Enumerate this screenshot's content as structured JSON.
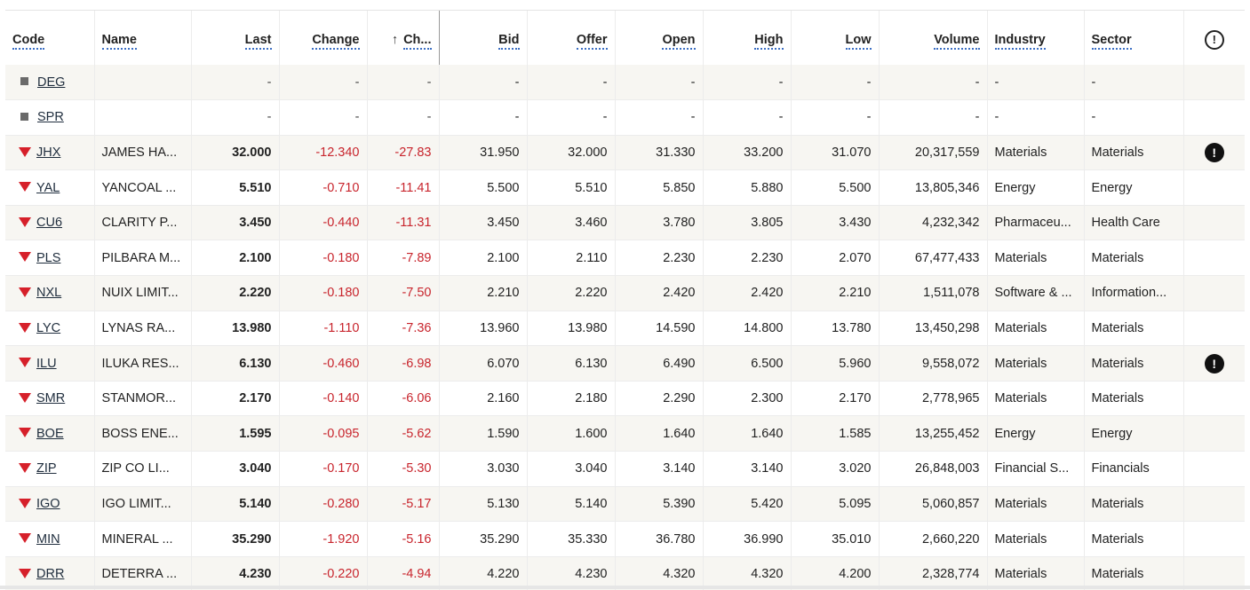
{
  "columns": {
    "code": "Code",
    "name": "Name",
    "last": "Last",
    "change": "Change",
    "change_pct": "Ch...",
    "bid": "Bid",
    "offer": "Offer",
    "open": "Open",
    "high": "High",
    "low": "Low",
    "volume": "Volume",
    "industry": "Industry",
    "sector": "Sector",
    "alerts_icon": "info-circle-icon",
    "sort_icon": "arrow-up-icon"
  },
  "sort_arrow_glyph": "↑",
  "alert_glyph": "!",
  "colors": {
    "negative": "#c8252d",
    "down_triangle": "#d6202a",
    "row_alt": "#f7f6f2",
    "link_underline": "#3b6fc4"
  },
  "rows": [
    {
      "code": "DEG",
      "indicator": "square",
      "name": "",
      "last": "-",
      "change": "-",
      "change_pct": "-",
      "bid": "-",
      "offer": "-",
      "open": "-",
      "high": "-",
      "low": "-",
      "volume": "-",
      "industry": "-",
      "sector": "-",
      "alert": false
    },
    {
      "code": "SPR",
      "indicator": "square",
      "name": "",
      "last": "-",
      "change": "-",
      "change_pct": "-",
      "bid": "-",
      "offer": "-",
      "open": "-",
      "high": "-",
      "low": "-",
      "volume": "-",
      "industry": "-",
      "sector": "-",
      "alert": false
    },
    {
      "code": "JHX",
      "indicator": "down",
      "name": "JAMES HA...",
      "last": "32.000",
      "change": "-12.340",
      "change_pct": "-27.83",
      "bid": "31.950",
      "offer": "32.000",
      "open": "31.330",
      "high": "33.200",
      "low": "31.070",
      "volume": "20,317,559",
      "industry": "Materials",
      "sector": "Materials",
      "alert": true
    },
    {
      "code": "YAL",
      "indicator": "down",
      "name": "YANCOAL ...",
      "last": "5.510",
      "change": "-0.710",
      "change_pct": "-11.41",
      "bid": "5.500",
      "offer": "5.510",
      "open": "5.850",
      "high": "5.880",
      "low": "5.500",
      "volume": "13,805,346",
      "industry": "Energy",
      "sector": "Energy",
      "alert": false
    },
    {
      "code": "CU6",
      "indicator": "down",
      "name": "CLARITY P...",
      "last": "3.450",
      "change": "-0.440",
      "change_pct": "-11.31",
      "bid": "3.450",
      "offer": "3.460",
      "open": "3.780",
      "high": "3.805",
      "low": "3.430",
      "volume": "4,232,342",
      "industry": "Pharmaceu...",
      "sector": "Health Care",
      "alert": false
    },
    {
      "code": "PLS",
      "indicator": "down",
      "name": "PILBARA M...",
      "last": "2.100",
      "change": "-0.180",
      "change_pct": "-7.89",
      "bid": "2.100",
      "offer": "2.110",
      "open": "2.230",
      "high": "2.230",
      "low": "2.070",
      "volume": "67,477,433",
      "industry": "Materials",
      "sector": "Materials",
      "alert": false
    },
    {
      "code": "NXL",
      "indicator": "down",
      "name": "NUIX LIMIT...",
      "last": "2.220",
      "change": "-0.180",
      "change_pct": "-7.50",
      "bid": "2.210",
      "offer": "2.220",
      "open": "2.420",
      "high": "2.420",
      "low": "2.210",
      "volume": "1,511,078",
      "industry": "Software & ...",
      "sector": "Information...",
      "alert": false
    },
    {
      "code": "LYC",
      "indicator": "down",
      "name": "LYNAS RA...",
      "last": "13.980",
      "change": "-1.110",
      "change_pct": "-7.36",
      "bid": "13.960",
      "offer": "13.980",
      "open": "14.590",
      "high": "14.800",
      "low": "13.780",
      "volume": "13,450,298",
      "industry": "Materials",
      "sector": "Materials",
      "alert": false
    },
    {
      "code": "ILU",
      "indicator": "down",
      "name": "ILUKA RES...",
      "last": "6.130",
      "change": "-0.460",
      "change_pct": "-6.98",
      "bid": "6.070",
      "offer": "6.130",
      "open": "6.490",
      "high": "6.500",
      "low": "5.960",
      "volume": "9,558,072",
      "industry": "Materials",
      "sector": "Materials",
      "alert": true
    },
    {
      "code": "SMR",
      "indicator": "down",
      "name": "STANMOR...",
      "last": "2.170",
      "change": "-0.140",
      "change_pct": "-6.06",
      "bid": "2.160",
      "offer": "2.180",
      "open": "2.290",
      "high": "2.300",
      "low": "2.170",
      "volume": "2,778,965",
      "industry": "Materials",
      "sector": "Materials",
      "alert": false
    },
    {
      "code": "BOE",
      "indicator": "down",
      "name": "BOSS ENE...",
      "last": "1.595",
      "change": "-0.095",
      "change_pct": "-5.62",
      "bid": "1.590",
      "offer": "1.600",
      "open": "1.640",
      "high": "1.640",
      "low": "1.585",
      "volume": "13,255,452",
      "industry": "Energy",
      "sector": "Energy",
      "alert": false
    },
    {
      "code": "ZIP",
      "indicator": "down",
      "name": "ZIP CO LI...",
      "last": "3.040",
      "change": "-0.170",
      "change_pct": "-5.30",
      "bid": "3.030",
      "offer": "3.040",
      "open": "3.140",
      "high": "3.140",
      "low": "3.020",
      "volume": "26,848,003",
      "industry": "Financial S...",
      "sector": "Financials",
      "alert": false
    },
    {
      "code": "IGO",
      "indicator": "down",
      "name": "IGO LIMIT...",
      "last": "5.140",
      "change": "-0.280",
      "change_pct": "-5.17",
      "bid": "5.130",
      "offer": "5.140",
      "open": "5.390",
      "high": "5.420",
      "low": "5.095",
      "volume": "5,060,857",
      "industry": "Materials",
      "sector": "Materials",
      "alert": false
    },
    {
      "code": "MIN",
      "indicator": "down",
      "name": "MINERAL ...",
      "last": "35.290",
      "change": "-1.920",
      "change_pct": "-5.16",
      "bid": "35.290",
      "offer": "35.330",
      "open": "36.780",
      "high": "36.990",
      "low": "35.010",
      "volume": "2,660,220",
      "industry": "Materials",
      "sector": "Materials",
      "alert": false
    },
    {
      "code": "DRR",
      "indicator": "down",
      "name": "DETERRA ...",
      "last": "4.230",
      "change": "-0.220",
      "change_pct": "-4.94",
      "bid": "4.220",
      "offer": "4.230",
      "open": "4.320",
      "high": "4.320",
      "low": "4.200",
      "volume": "2,328,774",
      "industry": "Materials",
      "sector": "Materials",
      "alert": false
    }
  ]
}
